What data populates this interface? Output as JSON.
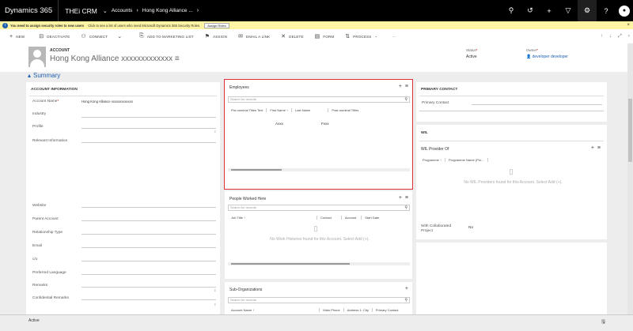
{
  "nav": {
    "brand": "Dynamics 365",
    "app": "THEi CRM",
    "breadcrumb": [
      "Accounts",
      "Hong Kong Alliance ..."
    ],
    "icons": [
      "search-icon",
      "history-icon",
      "plus-icon",
      "filter-icon",
      "settings-icon",
      "help-icon",
      "user-avatar"
    ]
  },
  "notification": {
    "bold": "You need to assign security roles to new users",
    "text": "Click to see a list of users who need Microsoft Dynamics 365 Security Roles.",
    "button": "Assign Roles",
    "close": "×"
  },
  "commands": {
    "new": "NEW",
    "deactivate": "DEACTIVATE",
    "connect": "CONNECT",
    "add_to_marketing_list": "ADD TO MARKETING LIST",
    "assign": "ASSIGN",
    "email_a_link": "EMAIL A LINK",
    "delete": "DELETE",
    "form": "FORM",
    "process": "PROCESS",
    "more": "···"
  },
  "header": {
    "entity_type": "ACCOUNT",
    "entity_name": "Hong Kong Alliance xxxxxxxxxxxxx",
    "status_label": "Status",
    "status_value": "Active",
    "owner_label": "Owner",
    "owner_value": "developer developer"
  },
  "summary": {
    "label": "Summary"
  },
  "account_info": {
    "title": "ACCOUNT INFORMATION",
    "fields": {
      "account_name_label": "Account Name",
      "account_name_value": "Hong Kong Alliance xxxxxxxxxxxxx",
      "industry": "Industry",
      "profile": "Profile",
      "relevant_info": "Relevant Information",
      "website": "Website",
      "parent_account": "Parent Account",
      "relationship_type": "Relationship Type",
      "email": "Email",
      "co": "c/o",
      "preferred_language": "Preferred Language",
      "remarks": "Remarks",
      "confidential_remarks": "Confidential Remarks"
    }
  },
  "employees": {
    "title": "Employees",
    "search_placeholder": "Search for records",
    "columns": [
      "Pre-nominal Titles Text",
      "First Name ↑",
      "Last Name",
      "Post-nominal Titles"
    ],
    "row": {
      "first_name": "Axxx",
      "last_name": "Fxxx"
    }
  },
  "people_worked": {
    "title": "People Worked Here",
    "search_placeholder": "Search for records",
    "columns": [
      "Job Title ↑",
      "Contact",
      "Account",
      "Start Date"
    ],
    "empty": "No Work Histories found for this Account. Select Add (+)."
  },
  "sub_orgs": {
    "title": "Sub-Organizations",
    "search_placeholder": "Search for records",
    "columns": [
      "Account Name ↑",
      "Main Phone",
      "Address 1: City",
      "Primary Contact"
    ]
  },
  "primary_contact": {
    "title": "PRIMARY CONTACT",
    "label": "Primary Contact"
  },
  "wil": {
    "title": "WIL",
    "provider_title": "WIL Provider Of",
    "columns": [
      "Programme ↑",
      "Programme Name (Pro..."
    ],
    "empty": "No WIL Providers found for this Account. Select Add (+).",
    "collab_label": "With Collaborated Project",
    "collab_value": "No"
  },
  "footer": {
    "status": "Active",
    "save": "🖫"
  }
}
